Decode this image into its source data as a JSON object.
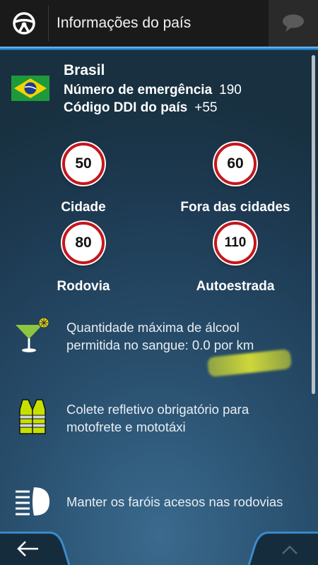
{
  "header": {
    "title": "Informações do país"
  },
  "country": {
    "name": "Brasil",
    "emergency_label": "Número de emergência",
    "emergency_value": "190",
    "ddi_label": "Código DDI do país",
    "ddi_value": "+55"
  },
  "speed_limits": [
    {
      "value": "50",
      "label": "Cidade"
    },
    {
      "value": "60",
      "label": "Fora das cidades"
    },
    {
      "value": "80",
      "label": "Rodovia"
    },
    {
      "value": "110",
      "label": "Autoestrada"
    }
  ],
  "rules": [
    {
      "icon": "cocktail-icon",
      "text_line1": "Quantidade máxima de álcool",
      "text_line2": "permitida no sangue: 0.0 por km"
    },
    {
      "icon": "safety-vest-icon",
      "text_line1": "Colete refletivo obrigatório para",
      "text_line2": "motofrete e mototáxi"
    },
    {
      "icon": "headlight-icon",
      "text_line1": "Manter os faróis acesos nas rodovias"
    }
  ],
  "icons": {
    "home": "steering-wheel-icon",
    "chat": "speech-bubble-icon",
    "back": "back-arrow-icon",
    "up": "chevron-up-icon"
  },
  "colors": {
    "accent": "#2b8ad8",
    "sign_border": "#c4161c",
    "highlight": "#e3e83a"
  }
}
